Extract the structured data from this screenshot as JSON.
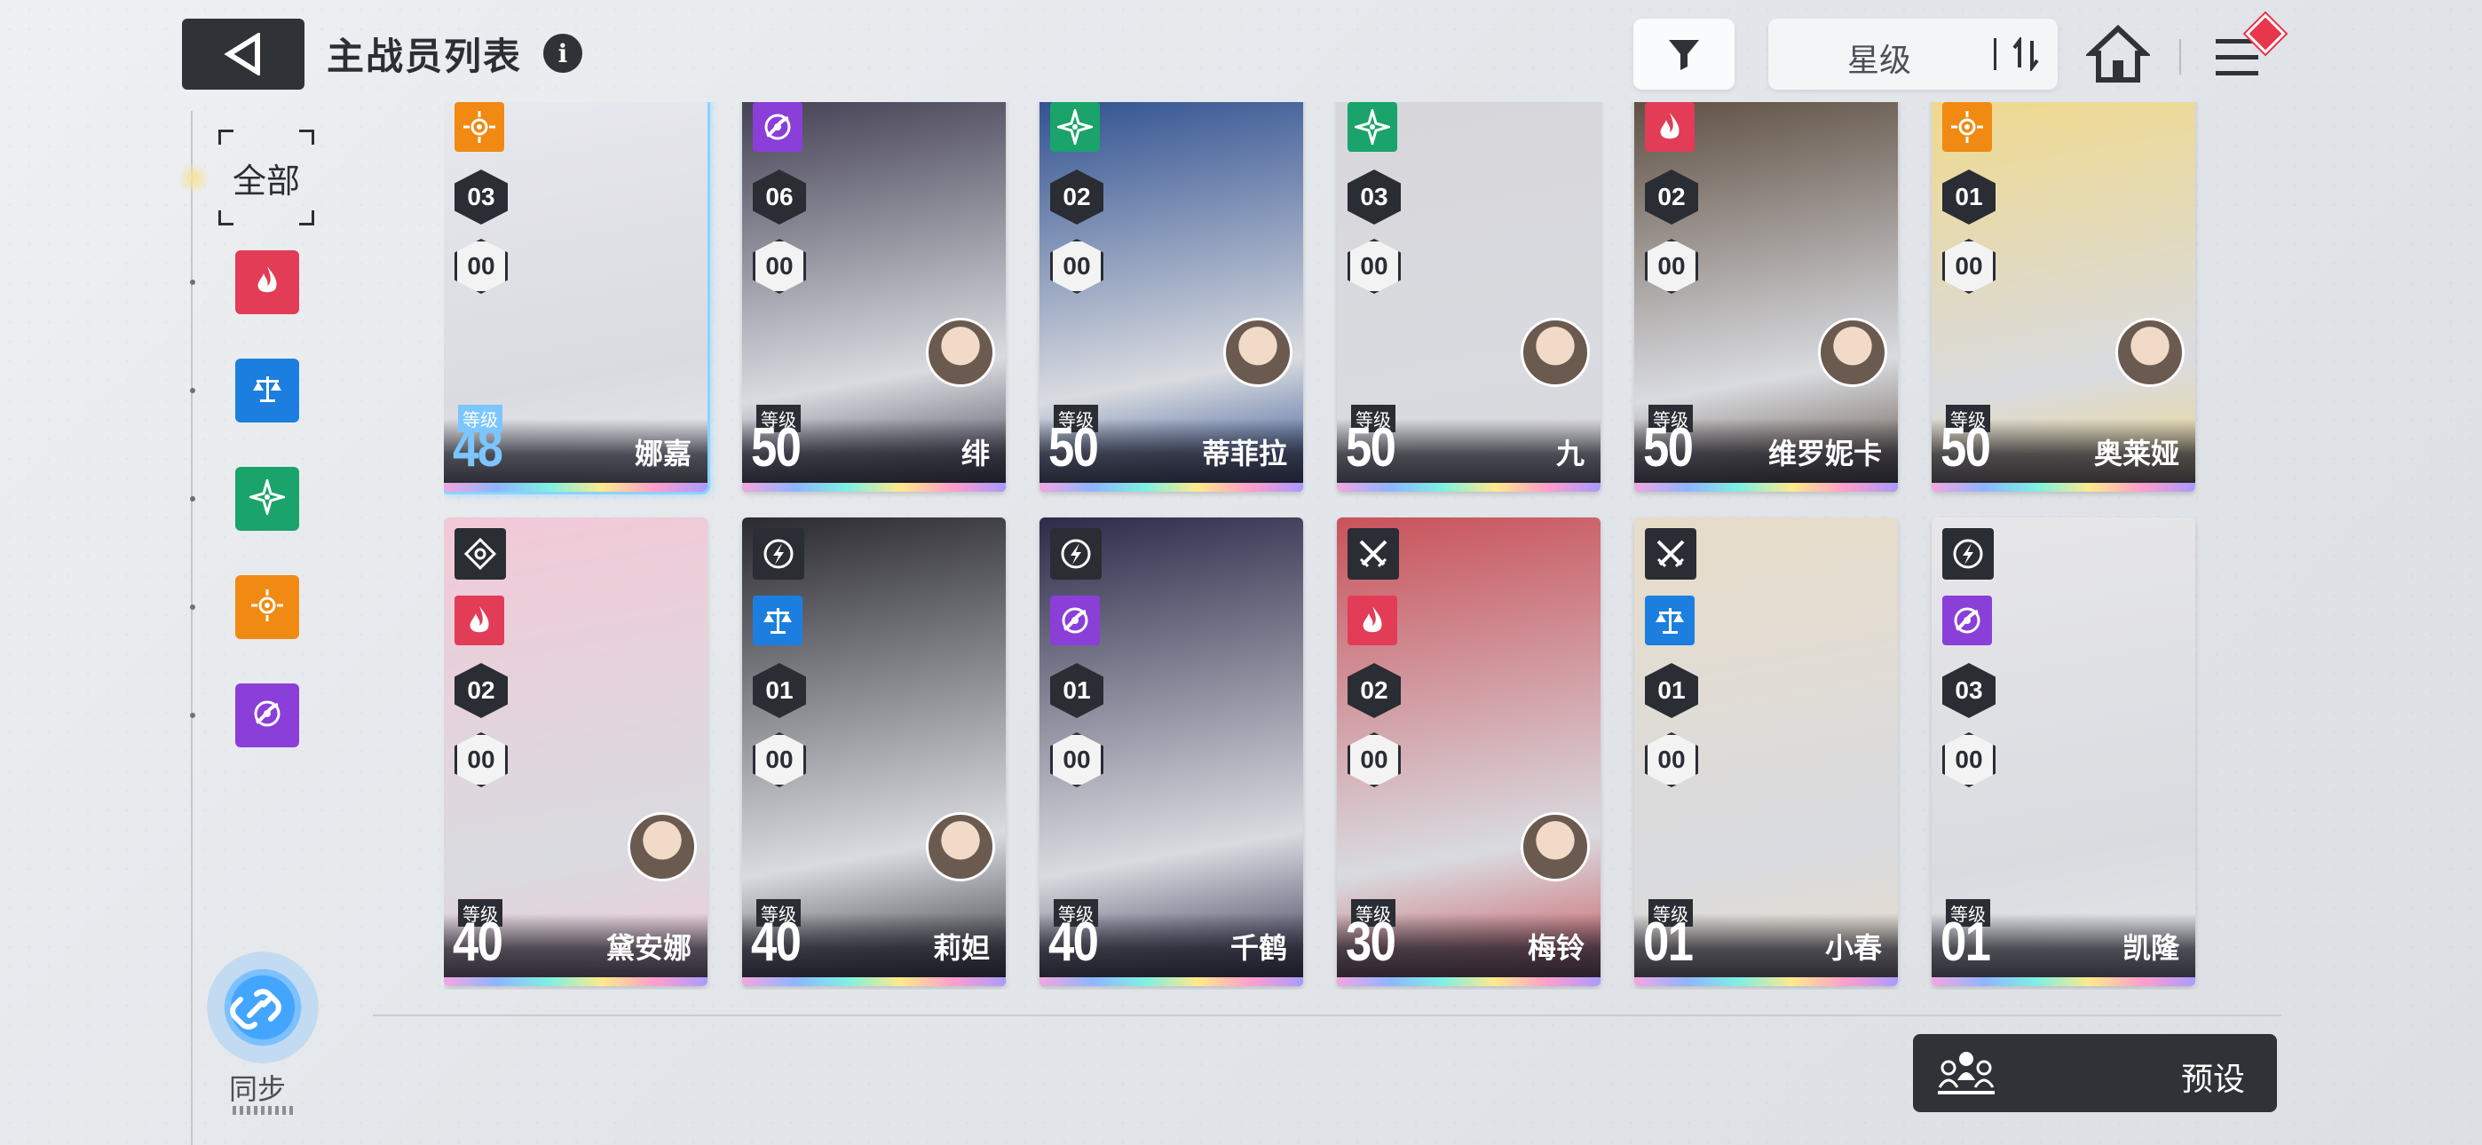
{
  "header": {
    "title": "主战员列表",
    "info_glyph": "i",
    "sort_label": "星级"
  },
  "sidebar": {
    "all_label": "全部",
    "elements": [
      {
        "icon": "flame-element-icon",
        "color": "#e23c57"
      },
      {
        "icon": "scales-element-icon",
        "color": "#1c7fe0"
      },
      {
        "icon": "star-compass-element-icon",
        "color": "#1aa36b"
      },
      {
        "icon": "sun-element-icon",
        "color": "#f08a12"
      },
      {
        "icon": "vortex-element-icon",
        "color": "#8a3fd8"
      }
    ]
  },
  "level_tag": "等级",
  "cards": [
    {
      "name": "娜嘉",
      "level": "48",
      "rank": "03",
      "sub": "00",
      "element": "sun-element-icon",
      "element_color": "#f08a12",
      "selected": true,
      "avatar": false,
      "tone": "#e9e9f0"
    },
    {
      "name": "绯",
      "level": "50",
      "rank": "06",
      "sub": "00",
      "element": "vortex-element-icon",
      "element_color": "#8a3fd8",
      "avatar": true,
      "tone": "#3d3a4e"
    },
    {
      "name": "蒂菲拉",
      "level": "50",
      "rank": "02",
      "sub": "00",
      "element": "star-compass-element-icon",
      "element_color": "#1aa36b",
      "avatar": true,
      "tone": "#2a4c8e"
    },
    {
      "name": "九",
      "level": "50",
      "rank": "03",
      "sub": "00",
      "element": "star-compass-element-icon",
      "element_color": "#1aa36b",
      "avatar": true,
      "tone": "#d7d6da"
    },
    {
      "name": "维罗妮卡",
      "level": "50",
      "rank": "02",
      "sub": "00",
      "element": "flame-element-icon",
      "element_color": "#e23c57",
      "avatar": true,
      "tone": "#5a4a3c"
    },
    {
      "name": "奥莱娅",
      "level": "50",
      "rank": "01",
      "sub": "00",
      "element": "sun-element-icon",
      "element_color": "#f08a12",
      "avatar": true,
      "tone": "#f1d98a"
    },
    {
      "name": "黛安娜",
      "level": "40",
      "rank": "02",
      "sub": "00",
      "element": "flame-element-icon",
      "element_color": "#e23c57",
      "role": "crosshair-role-icon",
      "avatar": true,
      "tone": "#f2c9d7"
    },
    {
      "name": "莉妲",
      "level": "40",
      "rank": "01",
      "sub": "00",
      "element": "scales-element-icon",
      "element_color": "#1c7fe0",
      "role": "lightning-role-icon",
      "avatar": true,
      "tone": "#2a2a30"
    },
    {
      "name": "千鹤",
      "level": "40",
      "rank": "01",
      "sub": "00",
      "element": "vortex-element-icon",
      "element_color": "#8a3fd8",
      "role": "lightning-role-icon",
      "avatar": false,
      "tone": "#2d2b4a"
    },
    {
      "name": "梅铃",
      "level": "30",
      "rank": "02",
      "sub": "00",
      "element": "flame-element-icon",
      "element_color": "#e23c57",
      "role": "crossed-swords-role-icon",
      "avatar": true,
      "tone": "#c9525a"
    },
    {
      "name": "小春",
      "level": "01",
      "rank": "01",
      "sub": "00",
      "element": "scales-element-icon",
      "element_color": "#1c7fe0",
      "role": "crossed-swords-role-icon",
      "avatar": false,
      "tone": "#e8dcc8"
    },
    {
      "name": "凯隆",
      "level": "01",
      "rank": "03",
      "sub": "00",
      "element": "vortex-element-icon",
      "element_color": "#8a3fd8",
      "role": "lightning-role-icon",
      "avatar": false,
      "tone": "#e7e7ea"
    }
  ],
  "footer": {
    "sync_label": "同步",
    "preset_label": "预设"
  }
}
